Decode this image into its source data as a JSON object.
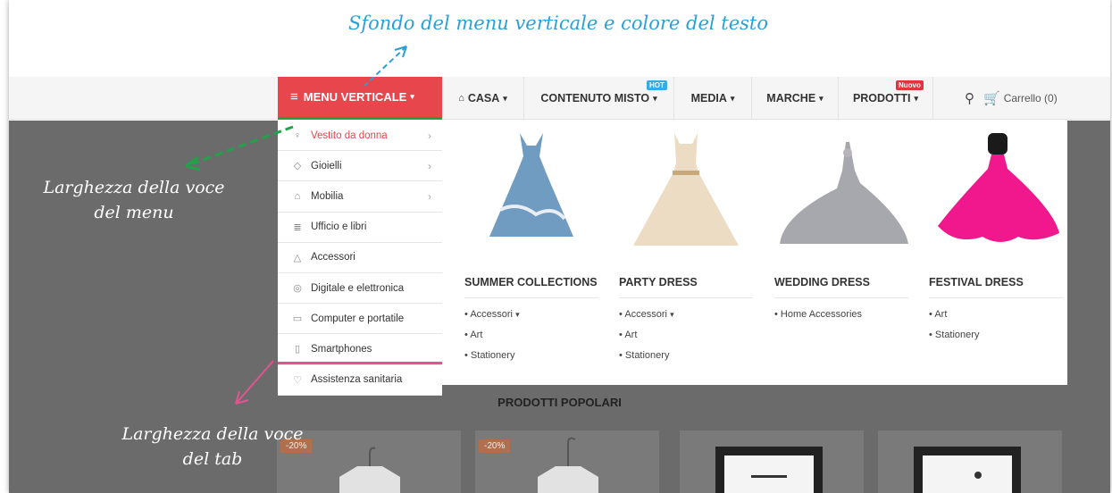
{
  "annotations": {
    "title": "Sfondo del menu verticale e colore del testo",
    "item_width_line1": "Larghezza della voce",
    "item_width_line2": "del menu",
    "tab_width_line1": "Larghezza della voce",
    "tab_width_line2": "del tab"
  },
  "colors": {
    "vertical_menu_bg": "#e8464d",
    "vertical_menu_accent": "#2e9b3f",
    "overlay": "#6b6b6b",
    "hot_badge": "#3aaae3",
    "new_badge": "#e0353c",
    "annotation_title": "#2aa0d8",
    "arrow_blue": "#2aa0d8",
    "arrow_green": "#22a04a",
    "arrow_pink": "#e0558f"
  },
  "vertical_menu": {
    "label": "MENU VERTICALE",
    "icon": "hamburger-icon",
    "items": [
      {
        "label": "Vestito da donna",
        "icon": "dress-icon",
        "submenu": true,
        "active": true
      },
      {
        "label": "Gioielli",
        "icon": "diamond-icon",
        "submenu": true
      },
      {
        "label": "Mobilia",
        "icon": "sofa-icon",
        "submenu": true
      },
      {
        "label": "Ufficio e libri",
        "icon": "books-icon",
        "submenu": false
      },
      {
        "label": "Accessori",
        "icon": "hanger-icon",
        "submenu": false
      },
      {
        "label": "Digitale e elettronica",
        "icon": "camera-icon",
        "submenu": false
      },
      {
        "label": "Computer e portatile",
        "icon": "laptop-icon",
        "submenu": false
      },
      {
        "label": "Smartphones",
        "icon": "phone-icon",
        "submenu": false
      },
      {
        "label": "Assistenza sanitaria",
        "icon": "health-icon",
        "submenu": false
      }
    ]
  },
  "nav": {
    "items": [
      {
        "label": "CASA",
        "icon": "home-icon"
      },
      {
        "label": "CONTENUTO MISTO",
        "badge": "HOT"
      },
      {
        "label": "MEDIA"
      },
      {
        "label": "MARCHE"
      },
      {
        "label": "PRODOTTI",
        "badge": "Nuovo"
      }
    ],
    "cart_label": "Carrello (0)"
  },
  "mega_menu": {
    "columns": [
      {
        "title": "SUMMER COLLECTIONS",
        "links": [
          "Accessori",
          "Art",
          "Stationery"
        ],
        "dress_color": "#6f9cc0"
      },
      {
        "title": "PARTY DRESS",
        "links": [
          "Accessori",
          "Art",
          "Stationery"
        ],
        "dress_color": "#ecdcc4"
      },
      {
        "title": "WEDDING DRESS",
        "links": [
          "Home Accessories"
        ],
        "dress_color": "#a7a7ae"
      },
      {
        "title": "FESTIVAL DRESS",
        "links": [
          "Art",
          "Stationery"
        ],
        "dress_color": "#f0188c"
      }
    ],
    "dropdown_links": [
      "Accessori"
    ]
  },
  "popular": {
    "title": "PRODOTTI POPOLARI",
    "discounts": [
      "-20%",
      "-20%"
    ]
  }
}
